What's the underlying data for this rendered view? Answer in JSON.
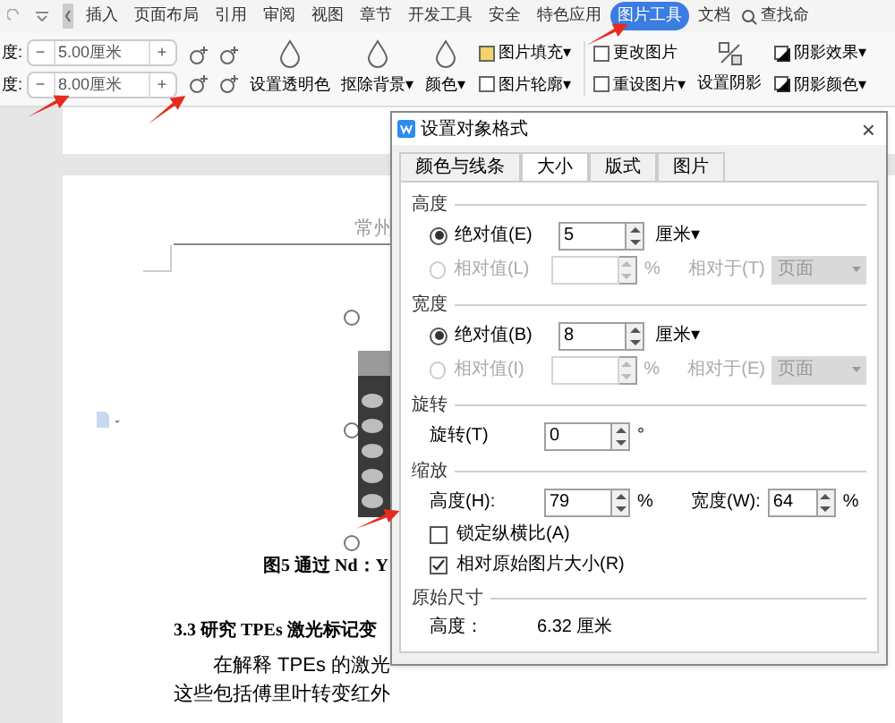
{
  "menu_tabs": [
    {
      "label": "插入",
      "selected": false
    },
    {
      "label": "页面布局",
      "selected": false
    },
    {
      "label": "引用",
      "selected": false
    },
    {
      "label": "审阅",
      "selected": false
    },
    {
      "label": "视图",
      "selected": false
    },
    {
      "label": "章节",
      "selected": false
    },
    {
      "label": "开发工具",
      "selected": false
    },
    {
      "label": "安全",
      "selected": false
    },
    {
      "label": "特色应用",
      "selected": false
    },
    {
      "label": "图片工具",
      "selected": true
    },
    {
      "label": "文档",
      "selected": false
    }
  ],
  "search": {
    "placeholder": "查找命"
  },
  "ribbon": {
    "size_fields": [
      {
        "label": "度:",
        "value": "5.00厘米",
        "minus": "−",
        "plus": "+"
      },
      {
        "label": "度:",
        "value": "8.00厘米",
        "minus": "−",
        "plus": "+"
      }
    ],
    "big_buttons": [
      {
        "label": "设置透明色"
      },
      {
        "label": "抠除背景",
        "caret": "▾"
      },
      {
        "label": "颜色",
        "caret": "▾"
      }
    ],
    "small_buttons": [
      {
        "label": "图片填充",
        "caret": "▾"
      },
      {
        "label": "图片轮廓",
        "caret": "▾"
      },
      {
        "label": "更改图片"
      },
      {
        "label": "重设图片",
        "caret": "▾"
      }
    ],
    "shadow": {
      "label": "设置阴影"
    },
    "shadow_buttons": [
      {
        "label": "阴影效果",
        "caret": "▾"
      },
      {
        "label": "阴影颜色",
        "caret": "▾"
      }
    ]
  },
  "document": {
    "header": "常州",
    "caption": "图5 通过 Nd：Y",
    "heading": "3.3 研究 TPEs 激光标记变",
    "paragraph_lines": [
      "在解释 TPEs 的激光",
      "这些包括傅里叶转变红外"
    ]
  },
  "dialog": {
    "title": "设置对象格式",
    "close": "×",
    "tabs": [
      {
        "label": "颜色与线条",
        "selected": false
      },
      {
        "label": "大小",
        "selected": true
      },
      {
        "label": "版式",
        "selected": false
      },
      {
        "label": "图片",
        "selected": false
      }
    ],
    "height": {
      "title": "高度",
      "absolute": {
        "label": "绝对值(E)",
        "selected": true,
        "value": "5",
        "unit": "厘米▾"
      },
      "relative": {
        "label": "相对值(L)",
        "selected": false,
        "disabled": true,
        "unit": "%",
        "relative_to": "相对于(T)",
        "relative_value": "页面"
      }
    },
    "width": {
      "title": "宽度",
      "absolute": {
        "label": "绝对值(B)",
        "selected": true,
        "value": "8",
        "unit": "厘米▾"
      },
      "relative": {
        "label": "相对值(I)",
        "selected": false,
        "disabled": true,
        "unit": "%",
        "relative_to": "相对于(E)",
        "relative_value": "页面"
      }
    },
    "rotation": {
      "title": "旋转",
      "label": "旋转(T)",
      "value": "0",
      "unit": "°"
    },
    "scale": {
      "title": "缩放",
      "height_label": "高度(H):",
      "height_value": "79",
      "height_unit": "%",
      "width_label": "宽度(W):",
      "width_value": "64",
      "width_unit": "%",
      "checkboxes": [
        {
          "label": "锁定纵横比(A)",
          "checked": false
        },
        {
          "label": "相对原始图片大小(R)",
          "checked": true
        }
      ]
    },
    "original": {
      "title": "原始尺寸",
      "label": "高度：",
      "value": "6.32 厘米"
    }
  }
}
